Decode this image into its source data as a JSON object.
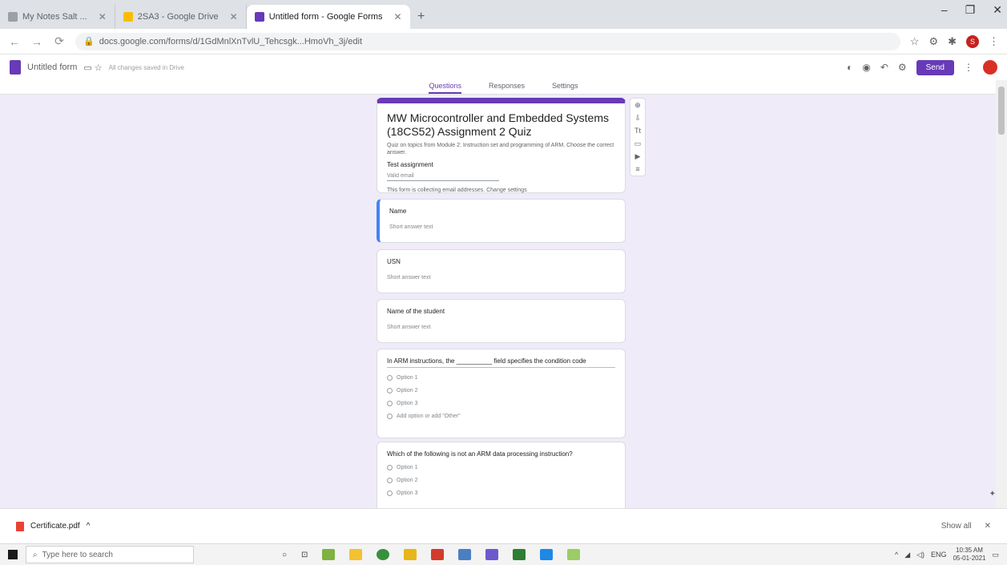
{
  "browser": {
    "tabs": [
      {
        "label": "My Notes Salt ...",
        "color": "#9aa0a6",
        "active": false
      },
      {
        "label": "2SA3 - Google Drive",
        "color": "#fbbc04",
        "active": false
      },
      {
        "label": "Untitled form - Google Forms",
        "color": "#673ab7",
        "active": true
      }
    ],
    "new_tab_label": "+",
    "window_controls": [
      "–",
      "❐",
      "✕"
    ],
    "address": "docs.google.com/forms/d/1GdMnlXnTvlU_Tehcsgk...HmoVh_3j/edit",
    "nav": {
      "back": "←",
      "forward": "→",
      "reload": "⟳"
    }
  },
  "forms_header": {
    "title": "Untitled form",
    "saved_text": "All changes saved in Drive",
    "send_label": "Send",
    "tools": [
      "palette",
      "eye",
      "undo",
      "settings"
    ]
  },
  "form_tabs": [
    "Questions",
    "Responses",
    "Settings"
  ],
  "form": {
    "title": "MW Microcontroller and Embedded Systems (18CS52) Assignment 2 Quiz",
    "description": "Quiz on topics from Module 2: Instruction set and programming of ARM. Choose the correct answer.",
    "sub": "Test assignment",
    "email_placeholder": "Valid email",
    "note": "This form is collecting email addresses. Change settings"
  },
  "questions": [
    {
      "label": "Name",
      "answer": "Short answer text",
      "selected": true
    },
    {
      "label": "USN",
      "answer": "Short answer text",
      "selected": false
    },
    {
      "label": "Name of the student",
      "answer": "Short answer text",
      "selected": false
    }
  ],
  "mc_question": {
    "title": "In ARM instructions, the __________ field specifies the condition code",
    "options": [
      "Option 1",
      "Option 2",
      "Option 3",
      "Add option or add \"Other\""
    ]
  },
  "mc_question2": {
    "title": "Which of the following is not an ARM data processing instruction?",
    "options": [
      "Option 1",
      "Option 2",
      "Option 3"
    ]
  },
  "side_toolbar": [
    "⊕",
    "⇩",
    "Tt",
    "▭",
    "▶",
    "≡"
  ],
  "download": {
    "file": "Certificate.pdf",
    "chevron": "^",
    "show_all": "Show all",
    "close": "✕"
  },
  "taskbar": {
    "search_placeholder": "Type here to search",
    "time": "10:35 AM",
    "date": "05-01-2021",
    "lang": "ENG"
  }
}
